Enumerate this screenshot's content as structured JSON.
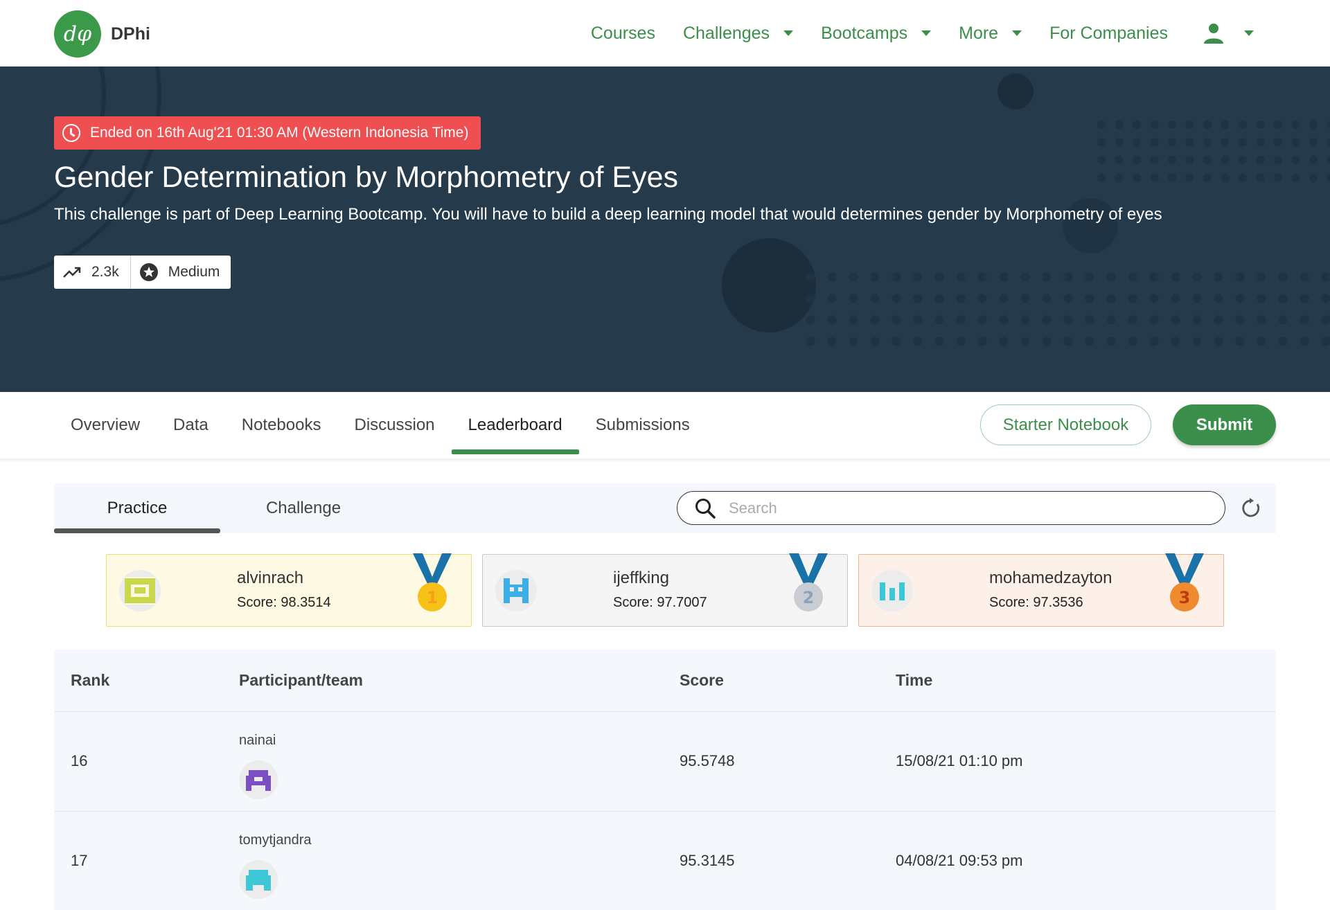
{
  "brand": {
    "logo_glyph": "dφ",
    "name": "DPhi"
  },
  "nav": {
    "items": [
      {
        "label": "Courses",
        "dropdown": false
      },
      {
        "label": "Challenges",
        "dropdown": true
      },
      {
        "label": "Bootcamps",
        "dropdown": true
      },
      {
        "label": "More",
        "dropdown": true
      },
      {
        "label": "For Companies",
        "dropdown": false
      }
    ],
    "user_icon": "user-icon"
  },
  "hero": {
    "deadline": "Ended on 16th Aug'21 01:30 AM (Western Indonesia Time)",
    "title": "Gender Determination by Morphometry of Eyes",
    "subtitle": "This challenge is part of Deep Learning Bootcamp. You will have to build a deep learning model that would determines gender by Morphometry of eyes",
    "views": "2.3k",
    "difficulty": "Medium"
  },
  "tabs": {
    "items": [
      "Overview",
      "Data",
      "Notebooks",
      "Discussion",
      "Leaderboard",
      "Submissions"
    ],
    "active": "Leaderboard",
    "starter_notebook": "Starter Notebook",
    "submit": "Submit"
  },
  "leaderboard": {
    "subtabs": [
      "Practice",
      "Challenge"
    ],
    "active_subtab": "Practice",
    "search_placeholder": "Search",
    "podium": [
      {
        "name": "alvinrach",
        "score": "Score: 98.3514",
        "place": "1",
        "avatar_color": "#c9d84a",
        "bg": "#fdf9e3",
        "border": "#ecdf7b",
        "medal_color": "#f5c116",
        "medal_text": "#f5a016"
      },
      {
        "name": "ijeffking",
        "score": "Score: 97.7007",
        "place": "2",
        "avatar_color": "#3eaee6",
        "bg": "#f5f5f6",
        "border": "#c9c9c9",
        "medal_color": "#c8cdd3",
        "medal_text": "#8ca3b8"
      },
      {
        "name": "mohamedzayton",
        "score": "Score: 97.3536",
        "place": "3",
        "avatar_color": "#3ec7d6",
        "bg": "#fcf0e8",
        "border": "#f0b48c",
        "medal_color": "#f08a2e",
        "medal_text": "#b83d0f"
      }
    ],
    "columns": [
      "Rank",
      "Participant/team",
      "Score",
      "Time"
    ],
    "rows": [
      {
        "rank": "16",
        "participant": "nainai",
        "score": "95.5748",
        "time": "15/08/21 01:10 pm",
        "avatar_color": "#7b4fc4"
      },
      {
        "rank": "17",
        "participant": "tomytjandra",
        "score": "95.3145",
        "time": "04/08/21 09:53 pm",
        "avatar_color": "#3ec7d6"
      }
    ]
  },
  "colors": {
    "brand_green": "#3b8f4a",
    "hero_bg": "#253a4a",
    "deadline_red": "#ef4f50"
  }
}
